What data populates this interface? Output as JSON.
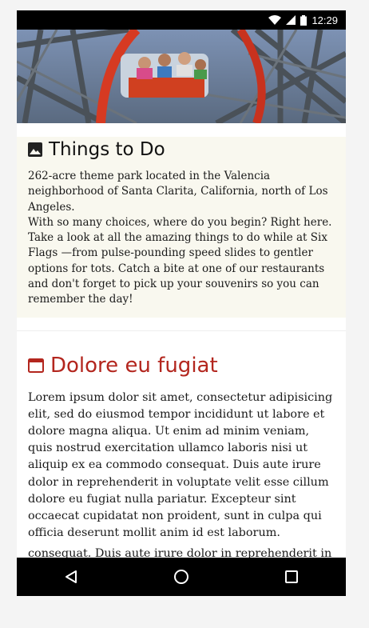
{
  "status_bar": {
    "time": "12:29",
    "icons": [
      "wifi-icon",
      "signal-icon",
      "battery-icon"
    ]
  },
  "card": {
    "icon": "image-icon",
    "title": "Things to Do",
    "body": "262-acre theme park located in the Valencia neighborhood of Santa Clarita, California, north of Los Angeles.\nWith so many choices, where do you begin? Right here. Take a look at all the amazing things to do while at Six Flags —from pulse-pounding speed slides to gentler options for tots. Catch a bite at one of our restaurants and don't forget to pick up your souvenirs so you can remember the day!"
  },
  "article": {
    "icon": "calendar-icon",
    "title": "Dolore eu fugiat",
    "paragraph1": "Lorem ipsum dolor sit amet, consectetur adipisicing elit, sed do eiusmod tempor incididunt ut labore et dolore magna aliqua. Ut enim ad minim veniam, quis nostrud exercitation ullamco laboris nisi ut aliquip ex ea commodo consequat. Duis aute irure dolor in reprehenderit in voluptate velit esse cillum dolore eu fugiat nulla pariatur. Excepteur sint occaecat cupidatat non proident, sunt in culpa qui officia deserunt mollit anim id est laborum.",
    "paragraph2": "consequat. Duis aute irure dolor in reprehenderit in voluptate velit essecillum dolore eu fugiat nulla"
  },
  "navigation": {
    "buttons": [
      "back-icon",
      "home-icon",
      "recents-icon"
    ]
  },
  "colors": {
    "card_bg": "#f9f8ef",
    "accent_red": "#b3261e",
    "bars": "#000000"
  }
}
